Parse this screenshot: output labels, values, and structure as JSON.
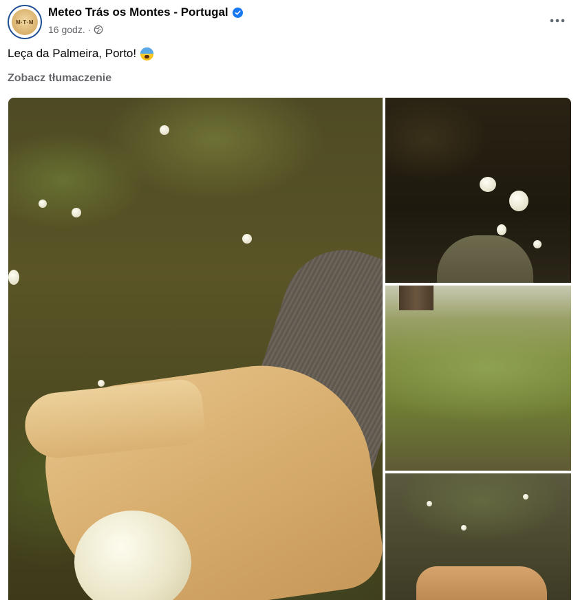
{
  "post": {
    "author": "Meteo Trás os Montes - Portugal",
    "avatar_text": "M·T·M",
    "timestamp": "16 godz.",
    "separator": "·",
    "audience_icon": "globe-icon",
    "verified_icon": "verified-badge-icon",
    "more_icon": "more-options-icon",
    "text": "Leça da Palmeira, Porto!",
    "emoji_icon": "anxious-face-emoji-icon",
    "translate_label": "Zobacz tłumaczenie"
  },
  "photos": [
    {
      "name": "hand-holding-hailstone",
      "icon": "photo"
    },
    {
      "name": "hailstones-near-shoe",
      "icon": "photo"
    },
    {
      "name": "lawn-covered-in-hail",
      "icon": "photo"
    },
    {
      "name": "hail-on-grass-with-hand",
      "icon": "photo"
    }
  ],
  "colors": {
    "accent": "#1877f2",
    "secondary_text": "#65676b",
    "primary_text": "#050505"
  }
}
